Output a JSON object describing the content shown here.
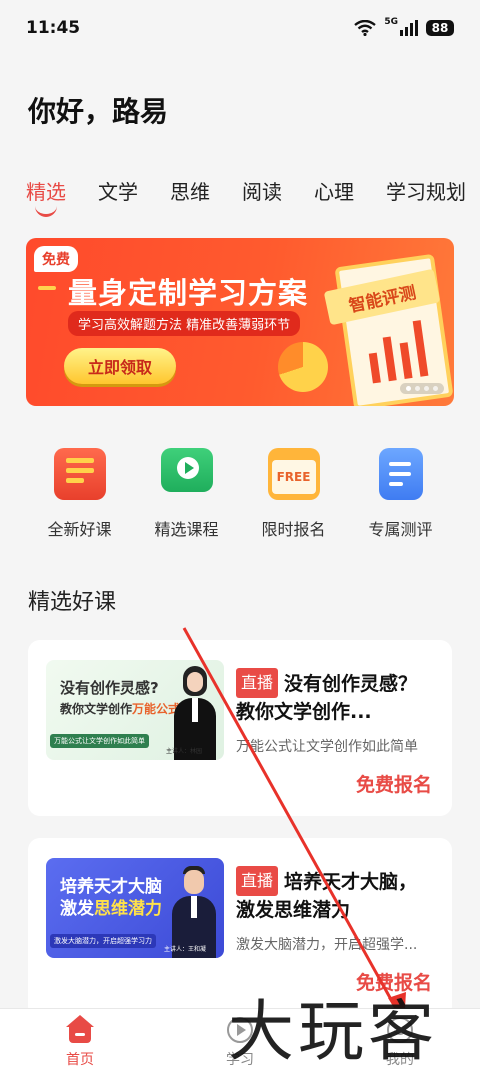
{
  "status_bar": {
    "time": "11:45",
    "network": "5G",
    "battery": "88"
  },
  "greeting": "你好，路易",
  "tabs": [
    {
      "label": "精选",
      "active": true
    },
    {
      "label": "文学",
      "active": false
    },
    {
      "label": "思维",
      "active": false
    },
    {
      "label": "阅读",
      "active": false
    },
    {
      "label": "心理",
      "active": false
    },
    {
      "label": "学习规划",
      "active": false
    }
  ],
  "banner": {
    "badge": "免费",
    "title": "量身定制学习方案",
    "subtitle": "学习高效解题方法  精准改善薄弱环节",
    "button": "立即领取",
    "board_title": "智能评测"
  },
  "quick_entries": [
    {
      "label": "全新好课",
      "icon": "book-icon"
    },
    {
      "label": "精选课程",
      "icon": "video-screen-icon"
    },
    {
      "label": "限时报名",
      "icon": "free-calendar-icon"
    },
    {
      "label": "专属测评",
      "icon": "document-icon"
    }
  ],
  "section_title": "精选好课",
  "courses": [
    {
      "thumb_line1": "没有创作灵感?",
      "thumb_line2": "教你文学创作",
      "thumb_highlight": "万能公式",
      "thumb_caption": "万能公式让文学创作如此简单",
      "thumb_teacher": "主讲人：林园",
      "badge": "直播",
      "title": "没有创作灵感？教你文学创作...",
      "desc": "万能公式让文学创作如此简单",
      "cta": "免费报名"
    },
    {
      "thumb_line1": "培养天才大脑",
      "thumb_line2": "激发",
      "thumb_highlight": "思维潜力",
      "thumb_caption": "激发大脑潜力，开启超强学习力",
      "thumb_teacher": "主讲人：王和凝",
      "badge": "直播",
      "title": "培养天才大脑，激发思维潜力",
      "desc": "激发大脑潜力，开启超强学...",
      "cta": "免费报名"
    }
  ],
  "bottom_nav": [
    {
      "label": "首页",
      "icon": "home-icon",
      "active": true
    },
    {
      "label": "学习",
      "icon": "play-circle-icon",
      "active": false
    },
    {
      "label": "我的",
      "icon": "profile-icon",
      "active": false
    }
  ],
  "watermark": "大玩客",
  "colors": {
    "accent": "#e84b46",
    "banner": "#ff4a2c"
  }
}
